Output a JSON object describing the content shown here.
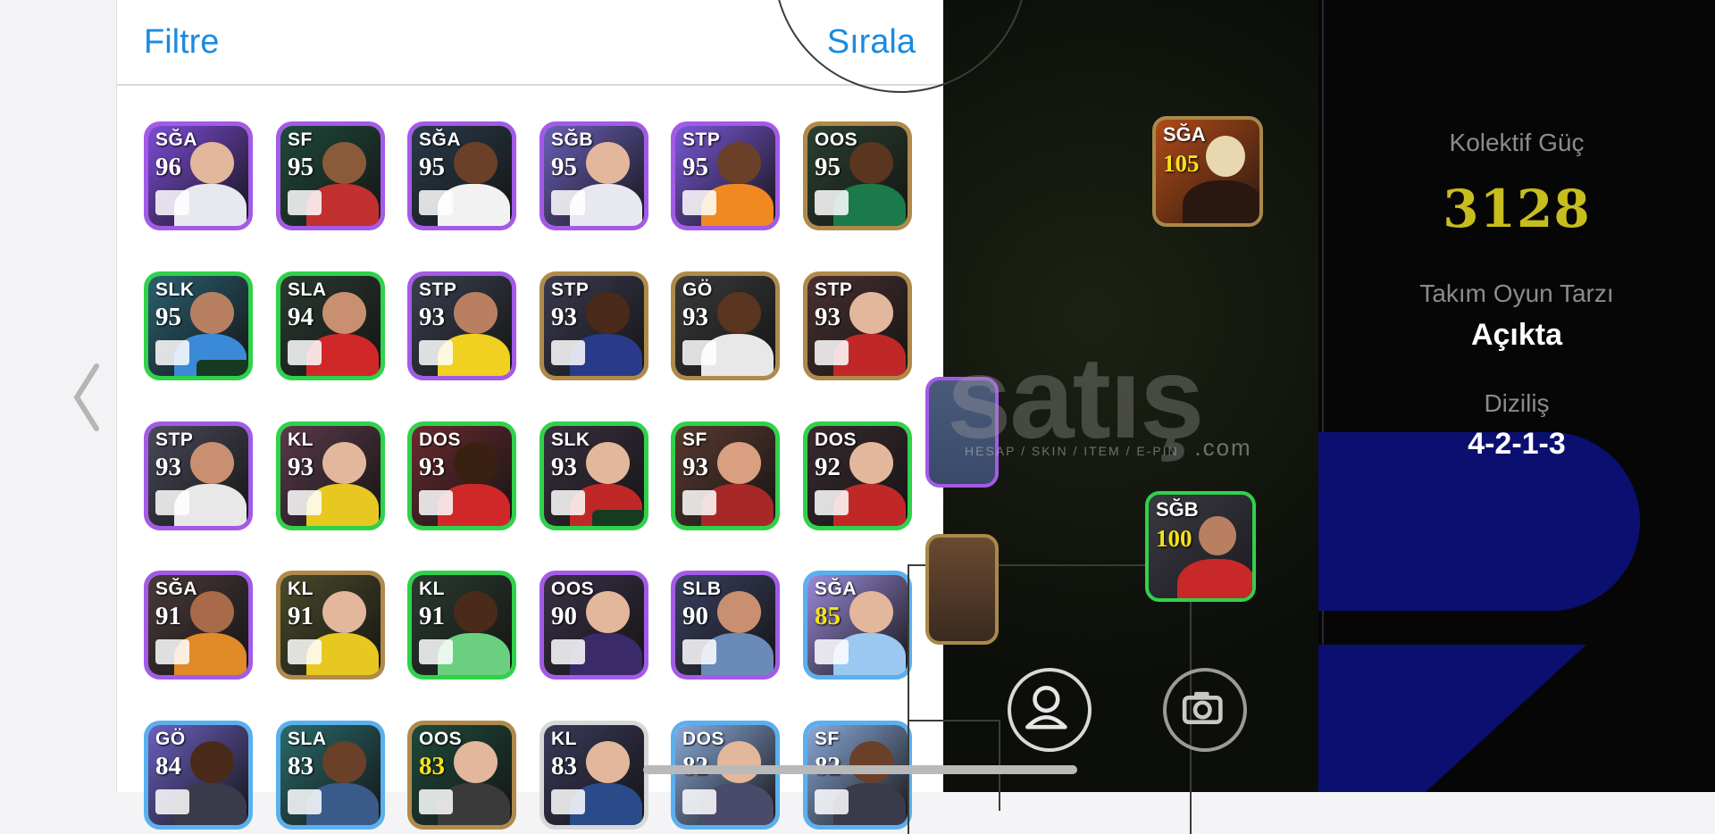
{
  "header": {
    "filter_label": "Filtre",
    "sort_label": "Sırala"
  },
  "players": [
    {
      "pos": "SĞA",
      "rating": "96",
      "border": "#a45ae8",
      "bg": "#7d4cd8",
      "skin": "#e3b79c",
      "kit": "#e8e8f0"
    },
    {
      "pos": "SF",
      "rating": "95",
      "border": "#a45ae8",
      "bg": "#1f4a3a",
      "skin": "#8a5a3a",
      "kit": "#c23030"
    },
    {
      "pos": "SĞA",
      "rating": "95",
      "border": "#a45ae8",
      "bg": "#2a3b4a",
      "skin": "#6a4028",
      "kit": "#f2f2f2"
    },
    {
      "pos": "SĞB",
      "rating": "95",
      "border": "#a45ae8",
      "bg": "#6b60b8",
      "skin": "#e3b79c",
      "kit": "#e8e8f0"
    },
    {
      "pos": "STP",
      "rating": "95",
      "border": "#a45ae8",
      "bg": "#7a58d8",
      "skin": "#6a4028",
      "kit": "#f08a20"
    },
    {
      "pos": "OOS",
      "rating": "95",
      "border": "#b08a4a",
      "bg": "#2a4030",
      "skin": "#5a3520",
      "kit": "#1a7a4a"
    },
    {
      "pos": "SLK",
      "rating": "95",
      "border": "#2fd24a",
      "bg": "#2a6070",
      "skin": "#b88060",
      "kit": "#3a8ad8"
    },
    {
      "pos": "SLA",
      "rating": "94",
      "border": "#2fd24a",
      "bg": "#2a3a30",
      "skin": "#c89070",
      "kit": "#d02828"
    },
    {
      "pos": "STP",
      "rating": "93",
      "border": "#a45ae8",
      "bg": "#3a4050",
      "skin": "#b88060",
      "kit": "#f0d020"
    },
    {
      "pos": "STP",
      "rating": "93",
      "border": "#b08a4a",
      "bg": "#3a3a50",
      "skin": "#4a2a18",
      "kit": "#2a3a8a"
    },
    {
      "pos": "GÖ",
      "rating": "93",
      "border": "#b08a4a",
      "bg": "#3a3a3a",
      "skin": "#5a3520",
      "kit": "#e8e8e8"
    },
    {
      "pos": "STP",
      "rating": "93",
      "border": "#b08a4a",
      "bg": "#4a3030",
      "skin": "#e3b79c",
      "kit": "#c02828"
    },
    {
      "pos": "STP",
      "rating": "93",
      "border": "#a45ae8",
      "bg": "#4a4a5a",
      "skin": "#c89070",
      "kit": "#e8e8e8"
    },
    {
      "pos": "KL",
      "rating": "93",
      "border": "#2fd24a",
      "bg": "#5a3a4a",
      "skin": "#e3b79c",
      "kit": "#e8c820"
    },
    {
      "pos": "DOS",
      "rating": "93",
      "border": "#2fd24a",
      "bg": "#6a2a30",
      "skin": "#3a2010",
      "kit": "#d02828"
    },
    {
      "pos": "SLK",
      "rating": "93",
      "border": "#2fd24a",
      "bg": "#3a3040",
      "skin": "#e3b79c",
      "kit": "#c02828"
    },
    {
      "pos": "SF",
      "rating": "93",
      "border": "#2fd24a",
      "bg": "#5a3a30",
      "skin": "#d8a080",
      "kit": "#a82828"
    },
    {
      "pos": "DOS",
      "rating": "92",
      "border": "#2fd24a",
      "bg": "#3a2a30",
      "skin": "#e3b79c",
      "kit": "#c02828"
    },
    {
      "pos": "SĞA",
      "rating": "91",
      "border": "#a45ae8",
      "bg": "#4a3a3a",
      "skin": "#a86a48",
      "kit": "#e08a28"
    },
    {
      "pos": "KL",
      "rating": "91",
      "border": "#b08a4a",
      "bg": "#4a4a2a",
      "skin": "#e3b79c",
      "kit": "#e8c820"
    },
    {
      "pos": "KL",
      "rating": "91",
      "border": "#2fd24a",
      "bg": "#2a3a30",
      "skin": "#4a2a18",
      "kit": "#6ad080"
    },
    {
      "pos": "OOS",
      "rating": "90",
      "border": "#a45ae8",
      "bg": "#3a3048",
      "skin": "#e3b79c",
      "kit": "#3a2a68"
    },
    {
      "pos": "SLB",
      "rating": "90",
      "border": "#a45ae8",
      "bg": "#3a4060",
      "skin": "#c89070",
      "kit": "#6a8ab8"
    },
    {
      "pos": "SĞA",
      "rating": "85",
      "border": "#5ab0ee",
      "bg": "#9a8ad8",
      "skin": "#e3b79c",
      "kit": "#9ac8f0"
    },
    {
      "pos": "GÖ",
      "rating": "84",
      "border": "#5ab0ee",
      "bg": "#6a60c0",
      "skin": "#4a2a18",
      "kit": "#3a3a4a"
    },
    {
      "pos": "SLA",
      "rating": "83",
      "border": "#5ab0ee",
      "bg": "#2a6a6a",
      "skin": "#6a4028",
      "kit": "#3a5a8a"
    },
    {
      "pos": "OOS",
      "rating": "83",
      "border": "#b08a4a",
      "bg": "#1f4a3a",
      "skin": "#e3b79c",
      "kit": "#3a3a3a"
    },
    {
      "pos": "KL",
      "rating": "83",
      "border": "#d8d8d8",
      "bg": "#3a3a5a",
      "skin": "#e3b79c",
      "kit": "#2a4a8a"
    },
    {
      "pos": "DOS",
      "rating": "82",
      "border": "#5ab0ee",
      "bg": "#8aa8d8",
      "skin": "#e3b79c",
      "kit": "#4a4a6a"
    },
    {
      "pos": "SF",
      "rating": "82",
      "border": "#5ab0ee",
      "bg": "#8aa8d8",
      "skin": "#6a4028",
      "kit": "#3a3a4a"
    }
  ],
  "squad_cards": [
    {
      "pos": "SĞA",
      "rating": "105"
    },
    {
      "pos": "SĞB",
      "rating": "100"
    }
  ],
  "info": {
    "collective_power_label": "Kolektif Güç",
    "collective_power_value": "3128",
    "play_style_label": "Takım Oyun Tarzı",
    "play_style_value": "Açıkta",
    "formation_label": "Diziliş",
    "formation_value": "4-2-1-3"
  },
  "watermark": {
    "main": "satış",
    "sub": "HESAP / SKIN / ITEM / E-PIN",
    "suffix": ".com"
  },
  "icons": [
    "chevron-left-icon",
    "profile-icon",
    "camera-icon"
  ],
  "colors": {
    "accent": "#1b8be0",
    "power": "#c7bd1d",
    "formation_pill": "#0b0f70"
  }
}
